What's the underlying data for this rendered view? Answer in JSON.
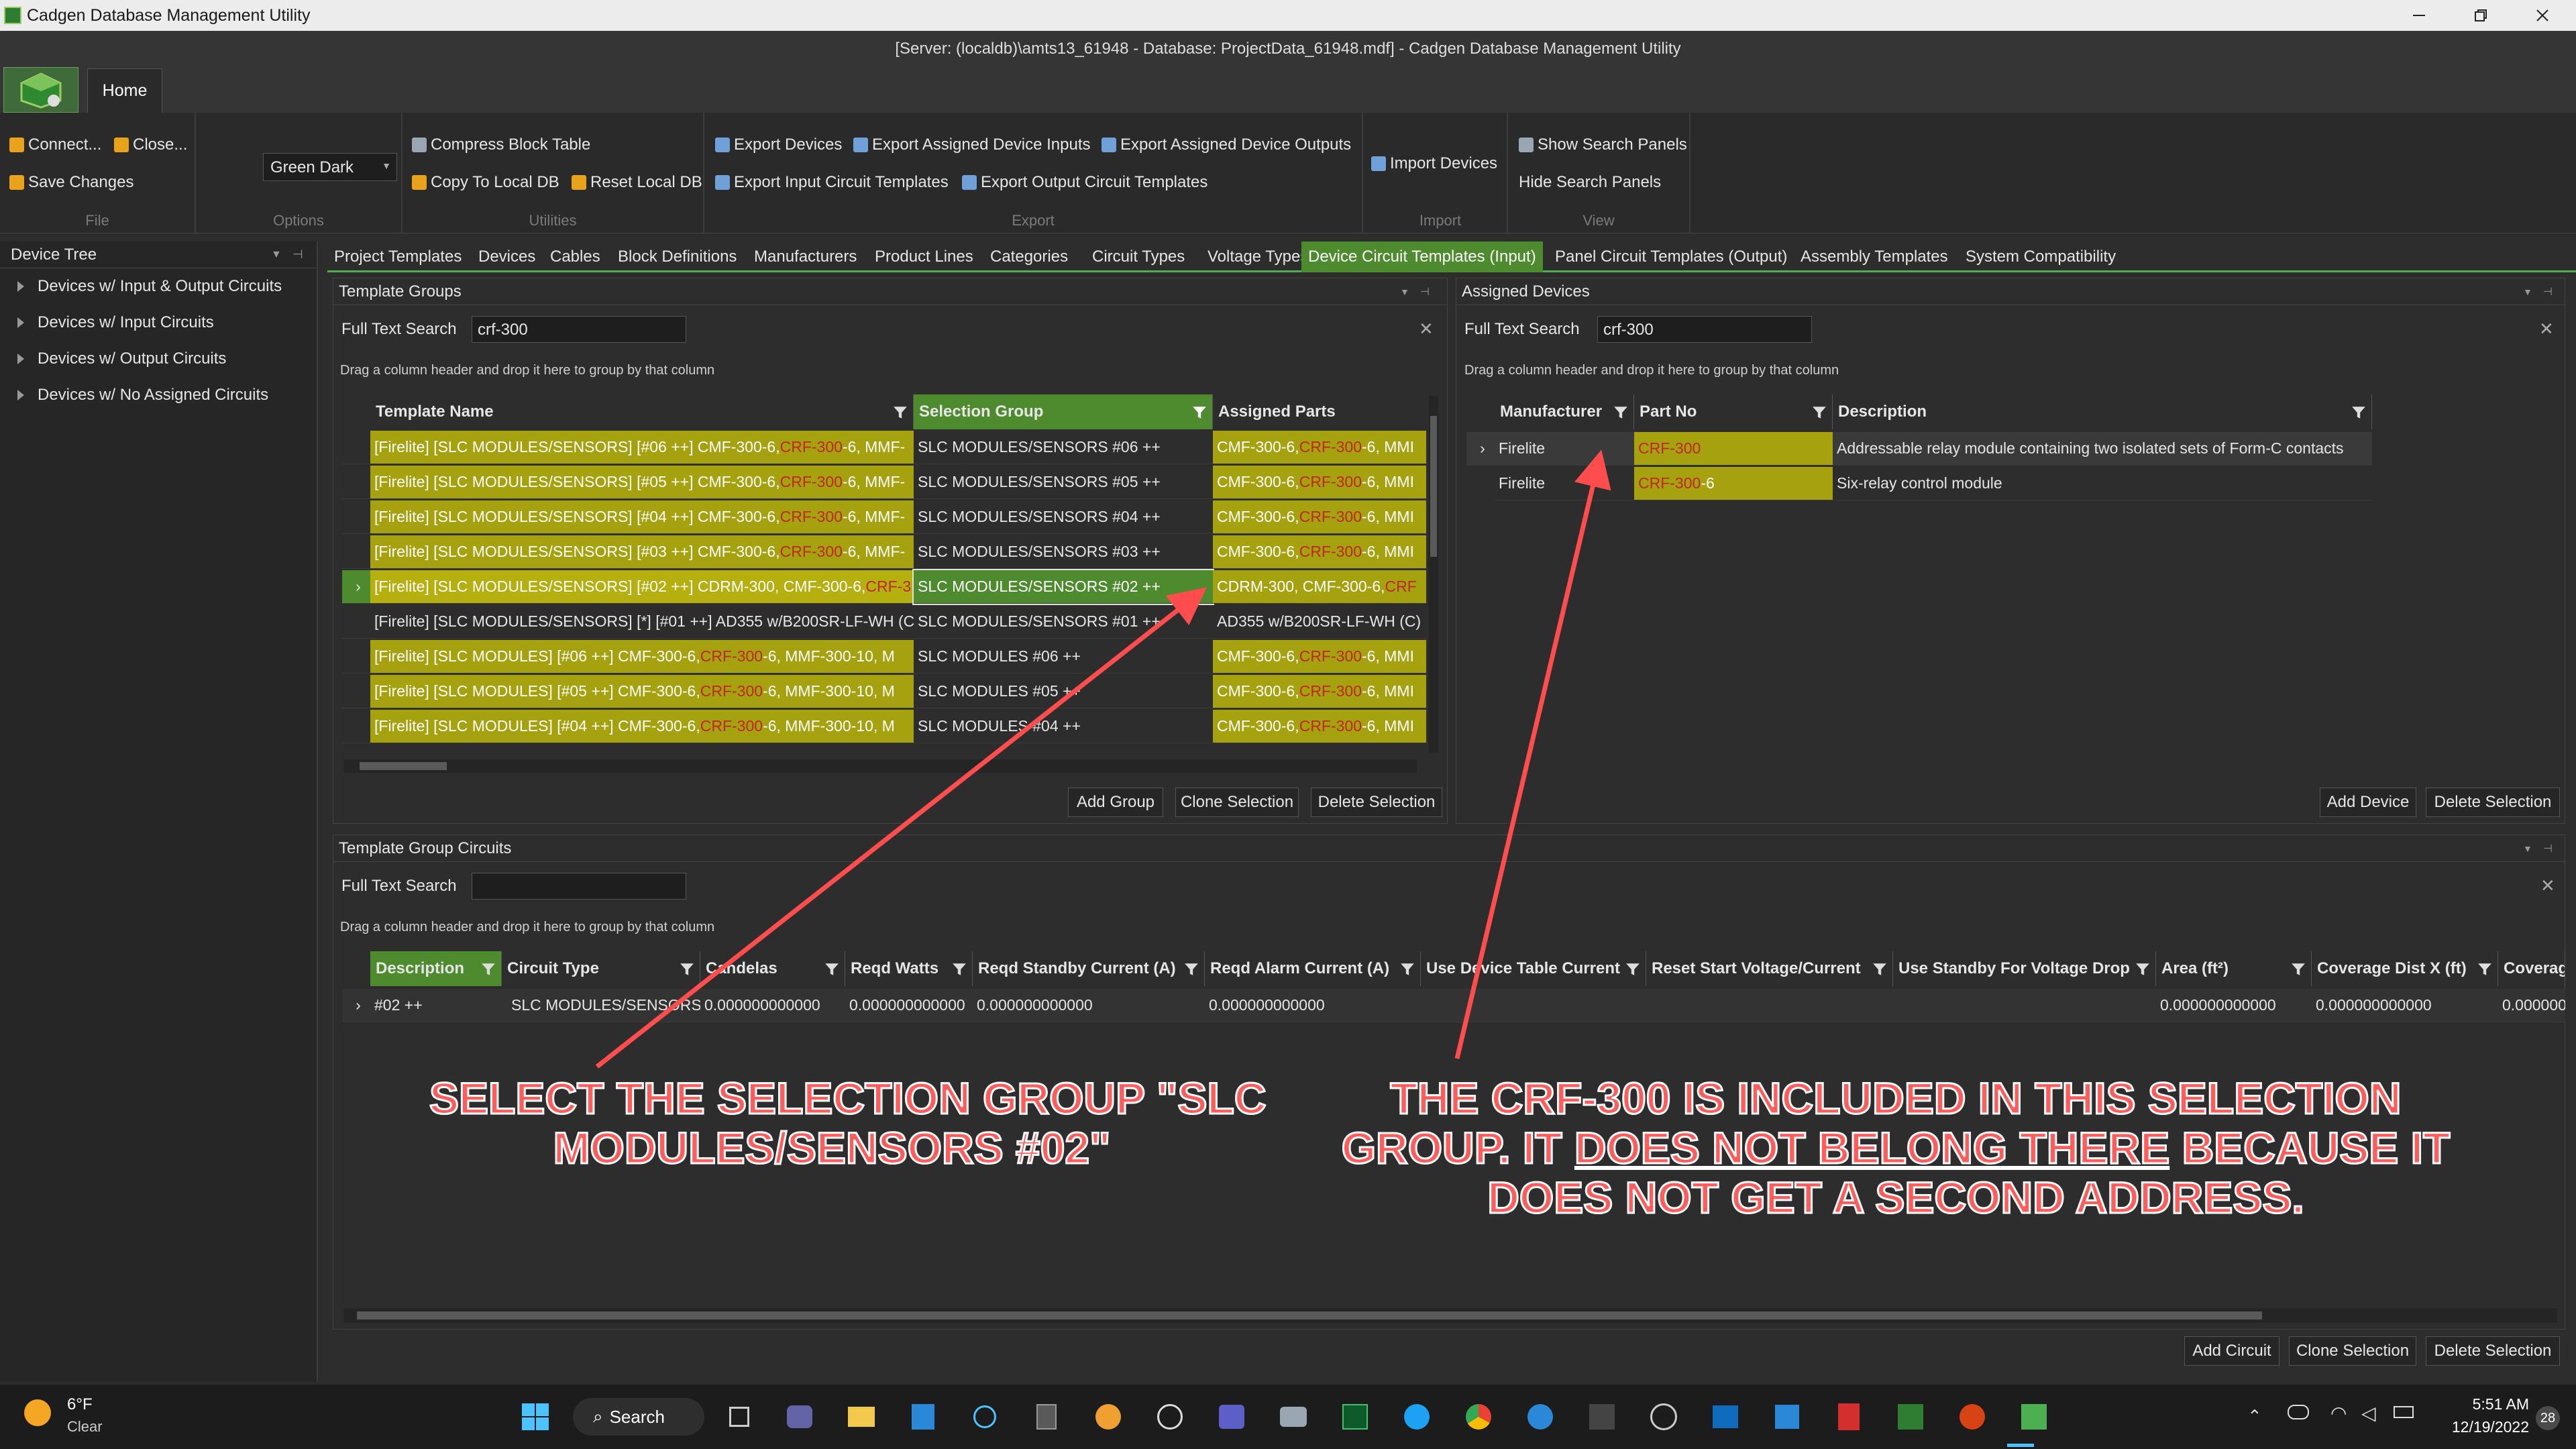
{
  "window": {
    "title": "Cadgen Database Management Utility",
    "subtitle": "[Server: (localdb)\\amts13_61948 - Database: ProjectData_61948.mdf] - Cadgen Database Management Utility"
  },
  "ribbon": {
    "tab_home": "Home",
    "file": {
      "connect": "Connect...",
      "close": "Close...",
      "save": "Save Changes",
      "group": "File"
    },
    "options": {
      "theme": "Green Dark",
      "group": "Options"
    },
    "utilities": {
      "compress": "Compress Block Table",
      "copy_local": "Copy To Local DB",
      "reset_local": "Reset Local DB",
      "group": "Utilities"
    },
    "export": {
      "export_devices": "Export Devices",
      "export_assigned_inputs": "Export Assigned Device Inputs",
      "export_assigned_outputs": "Export Assigned Device Outputs",
      "export_input_templates": "Export Input Circuit Templates",
      "export_output_templates": "Export Output Circuit Templates",
      "group": "Export"
    },
    "import": {
      "import_devices": "Import Devices",
      "group": "Import"
    },
    "view": {
      "show_search": "Show Search Panels",
      "hide_search": "Hide Search Panels",
      "group": "View"
    }
  },
  "device_tree": {
    "title": "Device Tree",
    "items": [
      "Devices w/ Input & Output Circuits",
      "Devices w/ Input Circuits",
      "Devices w/ Output Circuits",
      "Devices w/ No Assigned Circuits"
    ]
  },
  "tabs": [
    "Project Templates",
    "Devices",
    "Cables",
    "Block Definitions",
    "Manufacturers",
    "Product Lines",
    "Categories",
    "Circuit Types",
    "Voltage Types",
    "Device Circuit Templates (Input)",
    "Panel Circuit Templates (Output)",
    "Assembly Templates",
    "System Compatibility"
  ],
  "active_tab": "Device Circuit Templates (Input)",
  "template_groups": {
    "title": "Template Groups",
    "search_label": "Full Text Search",
    "search_value": "crf-300",
    "drag_hint": "Drag a column header and drop it here to group by that column",
    "columns": [
      "Template Name",
      "Selection Group",
      "Assigned Parts"
    ],
    "rows": [
      {
        "name_a": "[Firelite] [SLC MODULES/SENSORS] [#06 ++] CMF-300-6, ",
        "name_h": "CRF-300",
        "name_b": "-6, MMF-",
        "group": "SLC MODULES/SENSORS #06 ++",
        "parts_a": "CMF-300-6, ",
        "parts_h": "CRF-300",
        "parts_b": "-6, MMI"
      },
      {
        "name_a": "[Firelite] [SLC MODULES/SENSORS] [#05 ++] CMF-300-6, ",
        "name_h": "CRF-300",
        "name_b": "-6, MMF-",
        "group": "SLC MODULES/SENSORS #05 ++",
        "parts_a": "CMF-300-6, ",
        "parts_h": "CRF-300",
        "parts_b": "-6, MMI"
      },
      {
        "name_a": "[Firelite] [SLC MODULES/SENSORS] [#04 ++] CMF-300-6, ",
        "name_h": "CRF-300",
        "name_b": "-6, MMF-",
        "group": "SLC MODULES/SENSORS #04 ++",
        "parts_a": "CMF-300-6, ",
        "parts_h": "CRF-300",
        "parts_b": "-6, MMI"
      },
      {
        "name_a": "[Firelite] [SLC MODULES/SENSORS] [#03 ++] CMF-300-6, ",
        "name_h": "CRF-300",
        "name_b": "-6, MMF-",
        "group": "SLC MODULES/SENSORS #03 ++",
        "parts_a": "CMF-300-6, ",
        "parts_h": "CRF-300",
        "parts_b": "-6, MMI"
      },
      {
        "name_a": "[Firelite] [SLC MODULES/SENSORS] [#02 ++] CDRM-300, CMF-300-6, ",
        "name_h": "CRF-3",
        "name_b": "",
        "group": "SLC MODULES/SENSORS #02 ++",
        "parts_a": "CDRM-300, CMF-300-6, ",
        "parts_h": "CRF",
        "parts_b": ""
      },
      {
        "name_a": "[Firelite] [SLC MODULES/SENSORS] [*] [#01 ++] AD355 w/B200SR-LF-WH (C",
        "name_h": "",
        "name_b": "",
        "group": "SLC MODULES/SENSORS #01 ++",
        "parts_a": "AD355 w/B200SR-LF-WH (C)",
        "parts_h": "",
        "parts_b": ""
      },
      {
        "name_a": "[Firelite] [SLC MODULES] [#06 ++] CMF-300-6, ",
        "name_h": "CRF-300",
        "name_b": "-6, MMF-300-10, M",
        "group": "SLC MODULES #06 ++",
        "parts_a": "CMF-300-6, ",
        "parts_h": "CRF-300",
        "parts_b": "-6, MMI"
      },
      {
        "name_a": "[Firelite] [SLC MODULES] [#05 ++] CMF-300-6, ",
        "name_h": "CRF-300",
        "name_b": "-6, MMF-300-10, M",
        "group": "SLC MODULES #05 ++",
        "parts_a": "CMF-300-6, ",
        "parts_h": "CRF-300",
        "parts_b": "-6, MMI"
      },
      {
        "name_a": "[Firelite] [SLC MODULES] [#04 ++] CMF-300-6, ",
        "name_h": "CRF-300",
        "name_b": "-6, MMF-300-10, M",
        "group": "SLC MODULES #04 ++",
        "parts_a": "CMF-300-6, ",
        "parts_h": "CRF-300",
        "parts_b": "-6, MMI"
      }
    ],
    "buttons": {
      "add": "Add Group",
      "clone": "Clone Selection",
      "delete": "Delete Selection"
    }
  },
  "assigned_devices": {
    "title": "Assigned Devices",
    "search_label": "Full Text Search",
    "search_value": "crf-300",
    "drag_hint": "Drag a column header and drop it here to group by that column",
    "columns": [
      "Manufacturer",
      "Part No",
      "Description"
    ],
    "rows": [
      {
        "manufacturer": "Firelite",
        "part_h": "CRF-300",
        "part_b": "",
        "description": "Addressable relay module containing two isolated sets of Form-C contacts"
      },
      {
        "manufacturer": "Firelite",
        "part_h": "CRF-300",
        "part_b": "-6",
        "description": "Six-relay control module"
      }
    ],
    "buttons": {
      "add": "Add Device",
      "delete": "Delete Selection"
    }
  },
  "group_circuits": {
    "title": "Template Group Circuits",
    "search_label": "Full Text Search",
    "search_value": "",
    "drag_hint": "Drag a column header and drop it here to group by that column",
    "columns": [
      "Description",
      "Circuit Type",
      "Candelas",
      "Reqd Watts",
      "Reqd Standby Current (A)",
      "Reqd Alarm Current (A)",
      "Use Device Table Current",
      "Reset Start Voltage/Current",
      "Use Standby For Voltage Drop",
      "Area (ft²)",
      "Coverage Dist X (ft)",
      "Coverag"
    ],
    "row": [
      "#02 ++",
      "SLC MODULES/SENSORS",
      "0.000000000000",
      "0.000000000000",
      "0.000000000000",
      "0.000000000000",
      "",
      "",
      "",
      "0.000000000000",
      "0.000000000000",
      "0.000000"
    ],
    "buttons": {
      "add": "Add Circuit",
      "clone": "Clone Selection",
      "delete": "Delete Selection"
    }
  },
  "annotations": {
    "left_1": "SELECT THE SELECTION GROUP \"SLC",
    "left_2": "MODULES/SENSORS #02\"",
    "right_1": "THE CRF-300 IS INCLUDED IN THIS SELECTION",
    "right_2a": "GROUP. IT ",
    "right_2u": "DOES NOT BELONG THERE",
    "right_2b": " BECAUSE IT",
    "right_3": "DOES NOT GET A SECOND ADDRESS.",
    "color": "#ff5c5c"
  },
  "taskbar": {
    "weather_temp": "6°F",
    "weather_desc": "Clear",
    "search": "Search",
    "time": "5:51 AM",
    "date": "12/19/2022",
    "notification_count": "28"
  }
}
